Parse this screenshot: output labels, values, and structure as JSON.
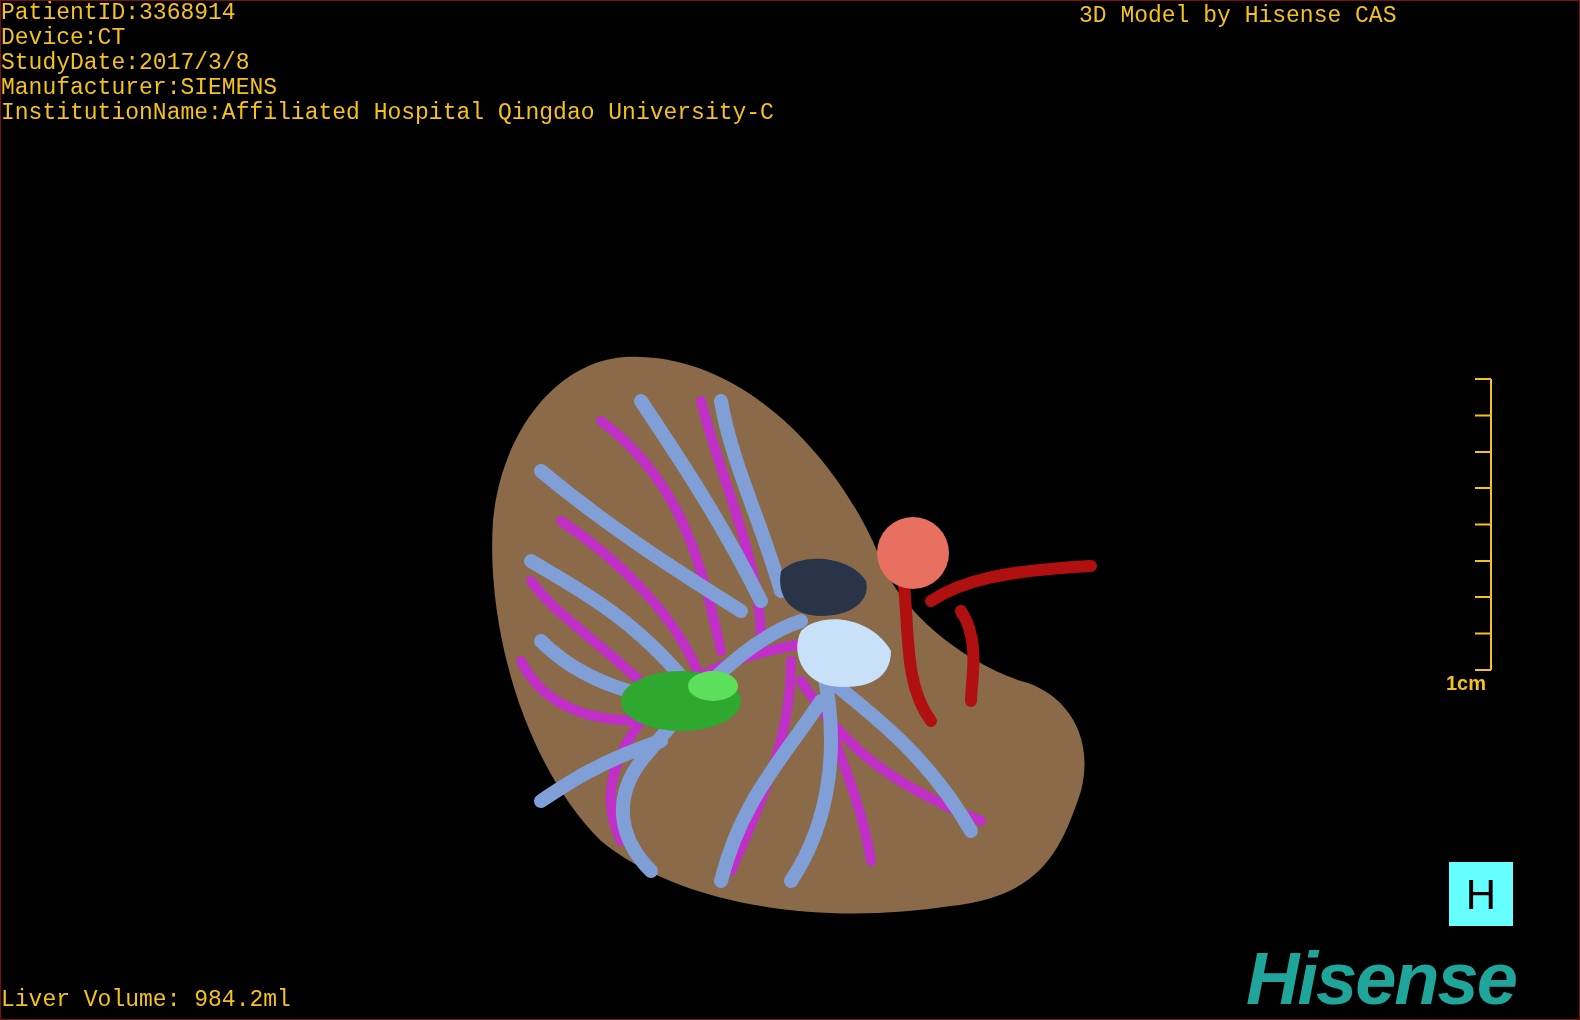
{
  "info_lines": [
    "PatientID:3368914",
    "Device:CT",
    "StudyDate:2017/3/8",
    "Manufacturer:SIEMENS",
    "InstitutionName:Affiliated Hospital Qingdao University-C"
  ],
  "model_credit": "3D Model by Hisense CAS",
  "scale_bar": {
    "label": "1cm"
  },
  "view_button": {
    "label": "H"
  },
  "logo": {
    "text": "Hisense"
  },
  "liver_volume": "Liver Volume: 984.2ml"
}
